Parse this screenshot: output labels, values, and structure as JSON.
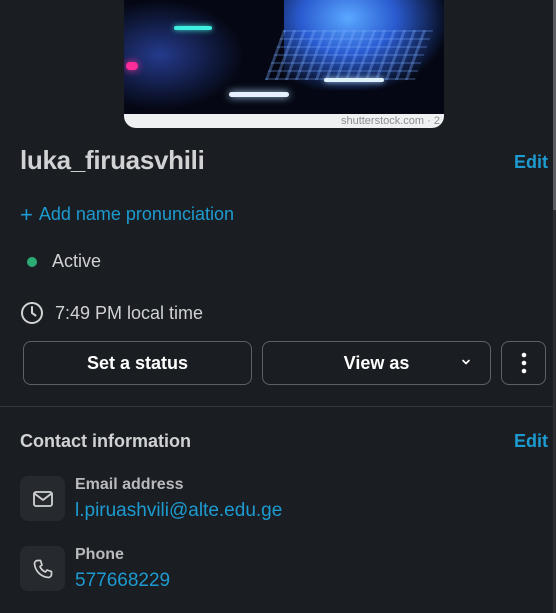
{
  "profile": {
    "photo_credit": "shutterstock.com · 2",
    "display_name": "luka_firuasvhili",
    "edit_label": "Edit",
    "add_pronunciation_label": "Add name pronunciation",
    "presence": "Active",
    "presence_color": "#2bac76",
    "local_time": "7:49 PM local time"
  },
  "actions": {
    "set_status_label": "Set a status",
    "view_as_label": "View as"
  },
  "contact": {
    "title": "Contact information",
    "edit_label": "Edit",
    "email_label": "Email address",
    "email_value": "l.piruashvili@alte.edu.ge",
    "phone_label": "Phone",
    "phone_value": "577668229"
  },
  "icons": {
    "add": "plus-icon",
    "clock": "clock-icon",
    "dropdown": "chevron-down-icon",
    "more": "more-vertical-icon",
    "email": "envelope-icon",
    "phone": "phone-icon"
  },
  "colors": {
    "background": "#1a1d21",
    "link": "#1d9bd1",
    "text": "#d1d2d3"
  }
}
